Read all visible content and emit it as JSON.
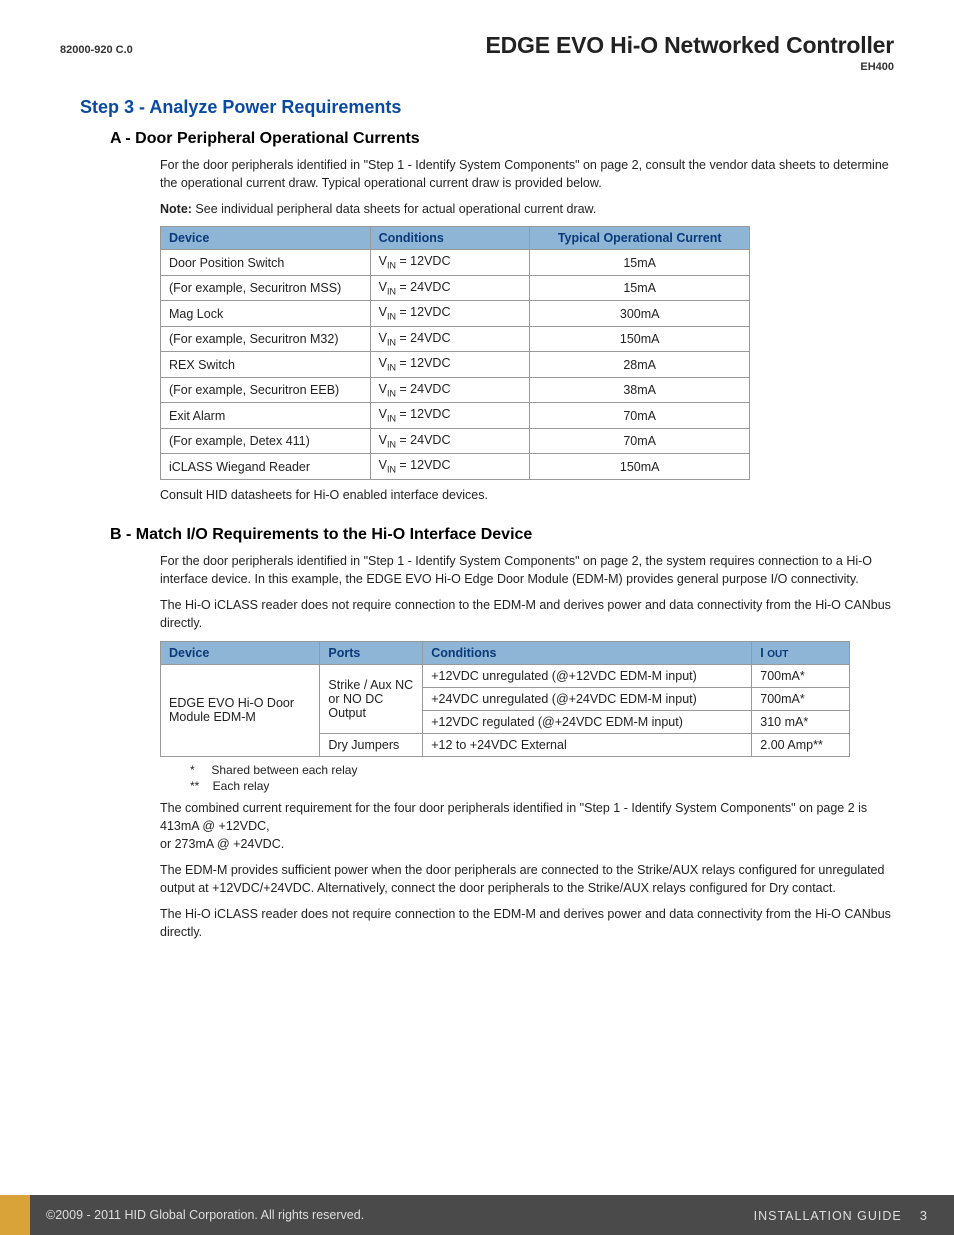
{
  "header": {
    "doc_code": "82000-920 C.0",
    "title": "EDGE EVO Hi-O Networked Controller",
    "subtitle": "EH400"
  },
  "step_heading": "Step 3 - Analyze Power Requirements",
  "section_a": {
    "heading": "A - Door Peripheral Operational Currents",
    "p1": "For the door peripherals identified in \"Step 1 - Identify System Components\" on page 2, consult the vendor data sheets to determine the operational current draw. Typical operational current draw is provided below.",
    "note_label": "Note:",
    "note_text": " See individual peripheral data sheets for actual operational current draw.",
    "table": {
      "h1": "Device",
      "h2": "Conditions",
      "h3": "Typical Operational Current",
      "rows": [
        {
          "device": "Door Position Switch",
          "cond_pre": "V",
          "cond_sub": "IN",
          "cond_post": " = 12VDC",
          "current": "15mA"
        },
        {
          "device": "(For example, Securitron MSS)",
          "cond_pre": "V",
          "cond_sub": "IN",
          "cond_post": " = 24VDC",
          "current": "15mA"
        },
        {
          "device": "Mag Lock",
          "cond_pre": "V",
          "cond_sub": "IN",
          "cond_post": " = 12VDC",
          "current": "300mA"
        },
        {
          "device": "(For example, Securitron M32)",
          "cond_pre": "V",
          "cond_sub": "IN",
          "cond_post": " = 24VDC",
          "current": "150mA"
        },
        {
          "device": "REX Switch",
          "cond_pre": "V",
          "cond_sub": "IN",
          "cond_post": " = 12VDC",
          "current": "28mA"
        },
        {
          "device": "(For example, Securitron EEB)",
          "cond_pre": "V",
          "cond_sub": "IN",
          "cond_post": " = 24VDC",
          "current": "38mA"
        },
        {
          "device": "Exit Alarm",
          "cond_pre": "V",
          "cond_sub": "IN",
          "cond_post": " = 12VDC",
          "current": "70mA"
        },
        {
          "device": "(For example, Detex 411)",
          "cond_pre": "V",
          "cond_sub": "IN",
          "cond_post": " = 24VDC",
          "current": "70mA"
        },
        {
          "device": "iCLASS Wiegand Reader",
          "cond_pre": "V",
          "cond_sub": "IN",
          "cond_post": " = 12VDC",
          "current": "150mA"
        }
      ]
    },
    "after": "Consult HID datasheets for Hi-O enabled interface devices."
  },
  "section_b": {
    "heading": "B - Match I/O  Requirements to the Hi-O Interface Device",
    "p1": "For the door peripherals identified in \"Step 1 - Identify System Components\" on page 2, the system requires connection to a Hi-O interface device. In this example, the EDGE EVO Hi-O Edge Door Module (EDM-M) provides general purpose I/O connectivity.",
    "p2": "The Hi-O iCLASS reader does not require connection to the EDM-M and derives power and data connectivity from the Hi-O CANbus directly.",
    "table": {
      "h1": "Device",
      "h2": "Ports",
      "h3": "Conditions",
      "h4_pre": "I ",
      "h4_sub": "OUT",
      "device": "EDGE EVO Hi-O Door Module EDM-M",
      "port1": "Strike / Aux NC or NO DC Output",
      "port2": "Dry Jumpers",
      "rows": [
        {
          "cond": "+12VDC unregulated (@+12VDC EDM-M input)",
          "iout": "700mA*"
        },
        {
          "cond": "+24VDC unregulated (@+24VDC EDM-M input)",
          "iout": "700mA*"
        },
        {
          "cond": "+12VDC regulated (@+24VDC EDM-M input)",
          "iout": "310 mA*"
        },
        {
          "cond": "+12 to +24VDC External",
          "iout": "2.00 Amp**"
        }
      ]
    },
    "fn1": "*     Shared between each relay",
    "fn2": "**    Each relay",
    "p3": "The combined current requirement for the four door peripherals identified in \"Step 1 - Identify System Components\" on page 2 is 413mA @ +12VDC,\nor 273mA @ +24VDC.",
    "p4": "The EDM-M provides sufficient power when the door peripherals are connected to the Strike/AUX relays configured for unregulated output at +12VDC/+24VDC. Alternatively, connect the door peripherals to the Strike/AUX relays configured for Dry contact.",
    "p5": "The Hi-O iCLASS reader does not require connection to the EDM-M and derives power and data connectivity from the Hi-O CANbus directly."
  },
  "footer": {
    "copyright": "©2009 - 2011 HID Global Corporation. All rights reserved.",
    "guide_label": "INSTALLATION GUIDE",
    "page_num": "3"
  }
}
